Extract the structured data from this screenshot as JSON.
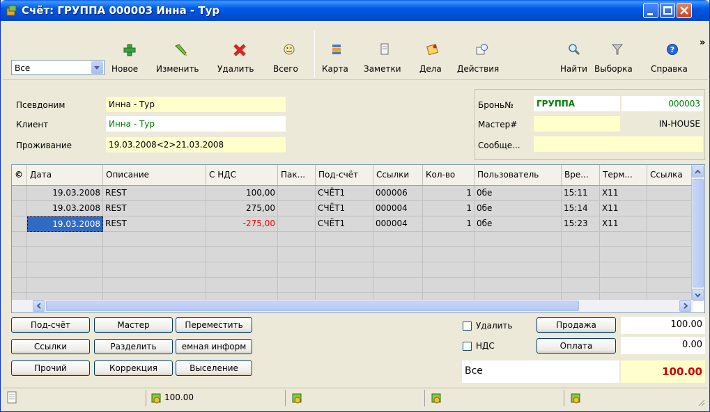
{
  "window": {
    "title": "Счёт: ГРУППА 000003 Инна - Тур"
  },
  "toolbar": {
    "filter_value": "Все",
    "buttons": [
      {
        "label": "Новое",
        "icon": "add-icon"
      },
      {
        "label": "Изменить",
        "icon": "edit-pencil-icon"
      },
      {
        "label": "Удалить",
        "icon": "delete-x-icon"
      },
      {
        "label": "Всего",
        "icon": "smiley-total-icon"
      },
      {
        "label": "Карта",
        "icon": "card-icon"
      },
      {
        "label": "Заметки",
        "icon": "notes-icon"
      },
      {
        "label": "Дела",
        "icon": "tasks-icon"
      },
      {
        "label": "Действия",
        "icon": "actions-icon"
      },
      {
        "label": "Найти",
        "icon": "search-icon"
      },
      {
        "label": "Выборка",
        "icon": "filter-funnel-icon"
      },
      {
        "label": "Справка",
        "icon": "help-icon"
      }
    ],
    "overflow": "»"
  },
  "info": {
    "alias_label": "Псевдоним",
    "alias_value": "Инна - Тур",
    "client_label": "Клиент",
    "client_value": "Инна - Тур",
    "stay_label": "Проживание",
    "stay_value": "19.03.2008<2>21.03.2008",
    "booking_label": "Бронь№",
    "booking_group": "ГРУППА",
    "booking_number": "000003",
    "master_label": "Мастер#",
    "master_value": "IN-HOUSE",
    "message_label": "Сообще...",
    "message_value": ""
  },
  "grid": {
    "columns": [
      "©",
      "Дата",
      "Описание",
      "С НДС",
      "Пак...",
      "Под-счёт",
      "Ссылки",
      "Кол-во",
      "Пользователь",
      "Вре...",
      "Терм...",
      "Ссылка"
    ],
    "rows": [
      {
        "date": "19.03.2008",
        "desc": "REST",
        "amount": "100,00",
        "sub": "СЧЁТ1",
        "ref": "000006",
        "qty": "1",
        "user": "0бе",
        "time": "15:11",
        "term": "X11"
      },
      {
        "date": "19.03.2008",
        "desc": "REST",
        "amount": "275,00",
        "sub": "СЧЁТ1",
        "ref": "000004",
        "qty": "1",
        "user": "0бе",
        "time": "15:14",
        "term": "X11"
      },
      {
        "date": "19.03.2008",
        "desc": "REST",
        "amount": "-275,00",
        "sub": "СЧЁТ1",
        "ref": "000004",
        "qty": "1",
        "user": "0бе",
        "time": "15:23",
        "term": "X11"
      }
    ]
  },
  "actions": {
    "subaccount": "Под-счёт",
    "master": "Мастер",
    "move": "Переместить",
    "links": "Ссылки",
    "split": "Разделить",
    "info": "емная информ",
    "other": "Прочий",
    "correction": "Коррекция",
    "checkout": "Выселение"
  },
  "totals": {
    "delete_label": "Удалить",
    "vat_label": "НДС",
    "sale_button": "Продажа",
    "payment_button": "Оплата",
    "sale_value": "100.00",
    "payment_value": "0.00",
    "all_label": "Все",
    "balance_value": "100.00"
  },
  "statusbar": {
    "total": "100.00"
  },
  "colors": {
    "title_bar": "#0054e3",
    "highlight_yellow": "#ffffcc",
    "green_text": "#008000",
    "negative_red": "#ff0000",
    "balance_red": "#cc0000"
  }
}
